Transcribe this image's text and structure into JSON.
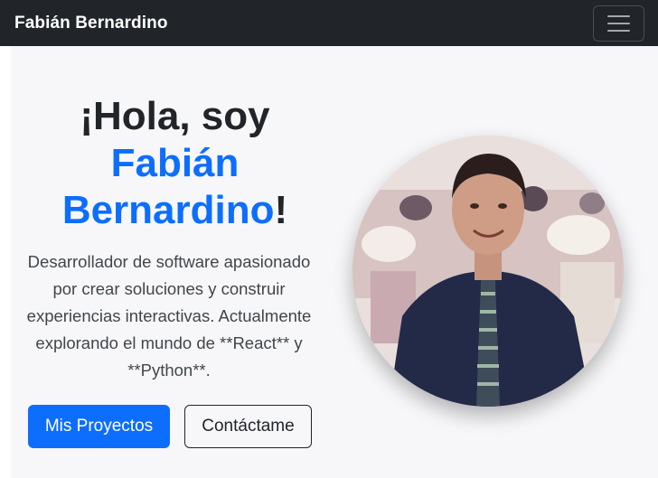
{
  "navbar": {
    "brand": "Fabián Bernardino",
    "toggler_icon": "hamburger-menu-icon"
  },
  "hero": {
    "greeting": "¡Hola, soy",
    "name_first": "Fabián",
    "name_last": "Bernardino",
    "exclamation": "!",
    "description": "Desarrollador de software apasionado por crear soluciones y construir experiencias interactivas. Actualmente explorando el mundo de **React** y **Python**.",
    "primary_button": "Mis Proyectos",
    "secondary_button": "Contáctame"
  },
  "colors": {
    "navbar_bg": "#212529",
    "accent": "#0d6efd",
    "hero_bg": "#f7f7f9"
  }
}
